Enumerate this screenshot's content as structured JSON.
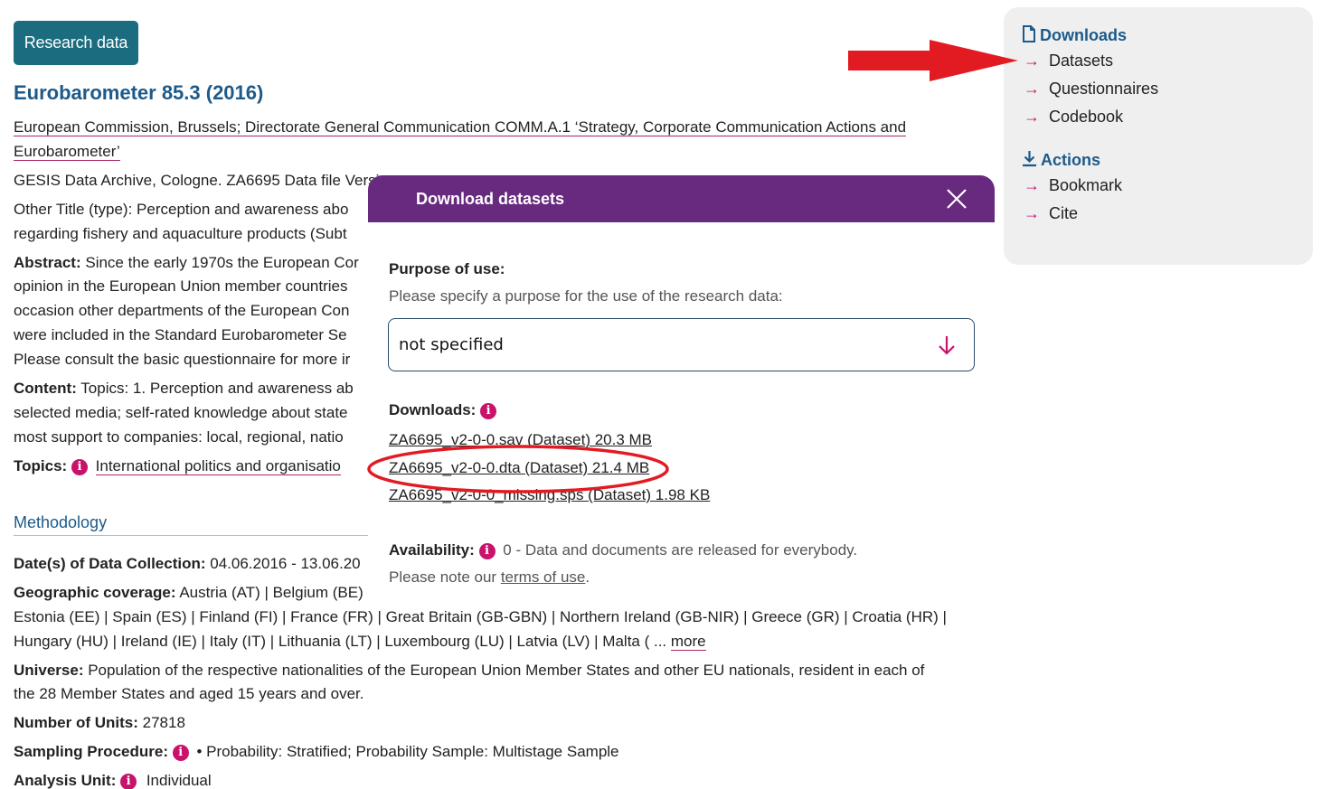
{
  "badge": "Research data",
  "title": "Eurobarometer 85.3 (2016)",
  "authors_line1": "European Commission, Brussels; Directorate General Communication COMM.A.1 ‘Strategy, Corporate Communication Actions and",
  "authors_line2": "Eurobarometer’",
  "gesis_line": "GESIS Data Archive, Cologne. ZA6695 Data file Versi",
  "other_title_1": "Other Title (type): Perception and awareness abo",
  "other_title_2": "regarding fishery and aquaculture products (Subt",
  "abstract": {
    "label": "Abstract:",
    "l1": "Since the early 1970s the European Cor",
    "l2": "opinion in the European Union member countries",
    "l3": "occasion other departments of the European Con",
    "l4": "were included in the Standard Eurobarometer Se",
    "l5": "Please consult the basic questionnaire for more ir"
  },
  "content": {
    "label": "Content:",
    "l1": "Topics: 1. Perception and awareness ab",
    "l2": "selected media; self-rated knowledge about state",
    "l3": "most support to companies: local, regional, natio"
  },
  "topics": {
    "label": "Topics:",
    "value": "International politics and organisatio"
  },
  "methodology": "Methodology",
  "dates": {
    "label": "Date(s) of Data Collection:",
    "value": "04.06.2016 - 13.06.20"
  },
  "geo": {
    "label": "Geographic coverage:",
    "l1": "Austria (AT) | Belgium (BE)",
    "l2": "Estonia (EE) | Spain (ES) | Finland (FI) | France (FR) | Great Britain (GB-GBN) | Northern Ireland (GB-NIR) | Greece (GR) | Croatia (HR) |",
    "l3": "Hungary (HU) | Ireland (IE) | Italy (IT) | Lithuania (LT) | Luxembourg (LU) | Latvia (LV) | Malta ( ...",
    "more": "more"
  },
  "universe": {
    "label": "Universe:",
    "l1": "Population of the respective nationalities of the European Union Member States and other EU nationals, resident in each of",
    "l2": "the 28 Member States and aged 15 years and over."
  },
  "units": {
    "label": "Number of Units:",
    "value": "27818"
  },
  "sampling": {
    "label": "Sampling Procedure:",
    "value": "• Probability: Stratified; Probability Sample: Multistage Sample"
  },
  "analysis": {
    "label": "Analysis Unit:",
    "value": "Individual"
  },
  "sidebar": {
    "downloads_head": "Downloads",
    "downloads": [
      "Datasets",
      "Questionnaires",
      "Codebook"
    ],
    "actions_head": "Actions",
    "actions": [
      "Bookmark",
      "Cite"
    ]
  },
  "modal": {
    "title": "Download datasets",
    "purpose_label": "Purpose of use:",
    "purpose_hint": "Please specify a purpose for the use of the research data:",
    "purpose_value": "not specified",
    "downloads_label": "Downloads:",
    "files": [
      "ZA6695_v2-0-0.sav (Dataset) 20.3 MB",
      "ZA6695_v2-0-0.dta (Dataset) 21.4 MB",
      "ZA6695_v2-0-0_missing.sps (Dataset) 1.98 KB"
    ],
    "availability_label": "Availability:",
    "availability_value": "0 - Data and documents are released for everybody.",
    "terms_prefix": "Please note our",
    "terms_link": "terms of use",
    "terms_suffix": "."
  },
  "colors": {
    "badge": "#1a6c7e",
    "title": "#1d5a8a",
    "modal_header": "#672a7e",
    "accent": "#c8136c",
    "annotation": "#e21b23"
  },
  "icons": [
    "document-icon",
    "download-icon",
    "arrow-right-icon",
    "info-icon",
    "close-icon",
    "arrow-down-icon"
  ]
}
